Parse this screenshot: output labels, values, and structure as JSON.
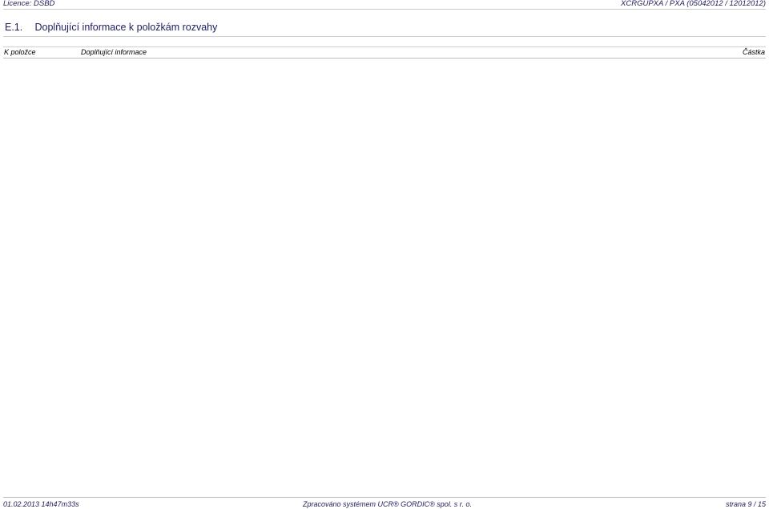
{
  "header": {
    "licence": "Licence: DSBD",
    "document_id": "XCRGUPXA / PXA  (05042012 / 12012012)"
  },
  "section": {
    "number": "E.1.",
    "title": "Doplňující informace k položkám rozvahy"
  },
  "table": {
    "columns": [
      "K položce",
      "Doplňující informace",
      "Částka"
    ]
  },
  "footer": {
    "timestamp": "01.02.2013 14h47m33s",
    "processed_by": "Zpracováno systémem  UCR® GORDIC® spol. s  r. o.",
    "page": "strana 9 / 15"
  }
}
